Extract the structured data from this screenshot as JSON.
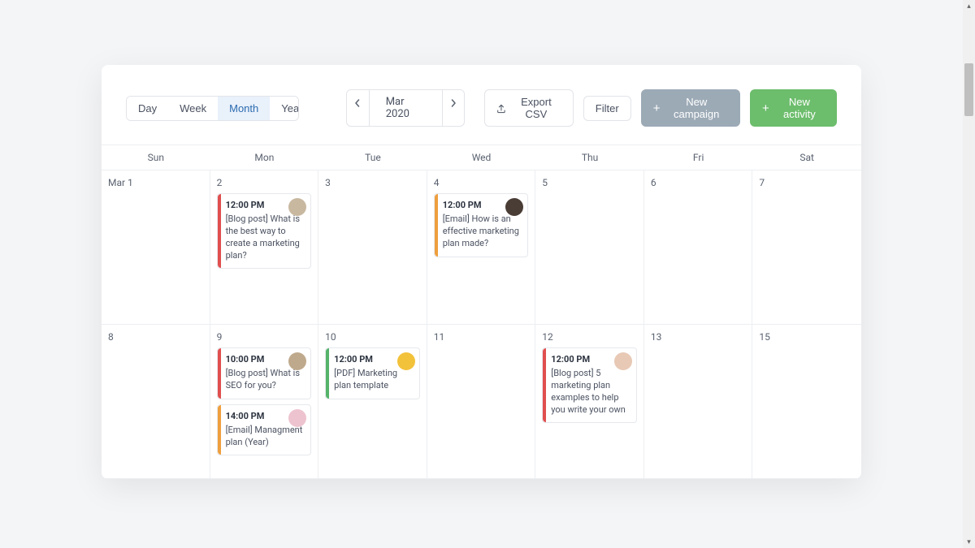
{
  "views": {
    "day": "Day",
    "week": "Week",
    "month": "Month",
    "year": "Year"
  },
  "date_label": "Mar 2020",
  "export_label": "Export CSV",
  "filter_label": "Filter",
  "new_campaign_label": "New campaign",
  "new_activity_label": "New activity",
  "weekdays": [
    "Sun",
    "Mon",
    "Tue",
    "Wed",
    "Thu",
    "Fri",
    "Sat"
  ],
  "row1": {
    "d0": "Mar 1",
    "d1": "2",
    "d2": "3",
    "d3": "4",
    "d4": "5",
    "d5": "6",
    "d6": "7"
  },
  "row2": {
    "d0": "8",
    "d1": "9",
    "d2": "10",
    "d3": "11",
    "d4": "12",
    "d5": "13",
    "d6": "15"
  },
  "events": {
    "e1": {
      "time": "12:00 PM",
      "title": "[Blog post] What is the best way to create a marketing plan?",
      "avatar_bg": "#c9b8a0"
    },
    "e2": {
      "time": "12:00 PM",
      "title": "[Email] How is an effective marketing plan made?",
      "avatar_bg": "#4a3d36"
    },
    "e3": {
      "time": "10:00 PM",
      "title": "[Blog post] What is SEO for you?",
      "avatar_bg": "#bfa98c"
    },
    "e4": {
      "time": "14:00 PM",
      "title": "[Email] Managment plan (Year)",
      "avatar_bg": "#edc3cf"
    },
    "e5": {
      "time": "12:00 PM",
      "title": "[PDF] Marketing plan template",
      "avatar_bg": "#f3c23b"
    },
    "e6": {
      "time": "12:00 PM",
      "title": "[Blog post] 5 marketing plan examples to help you write your own",
      "avatar_bg": "#e8c9b5"
    }
  }
}
